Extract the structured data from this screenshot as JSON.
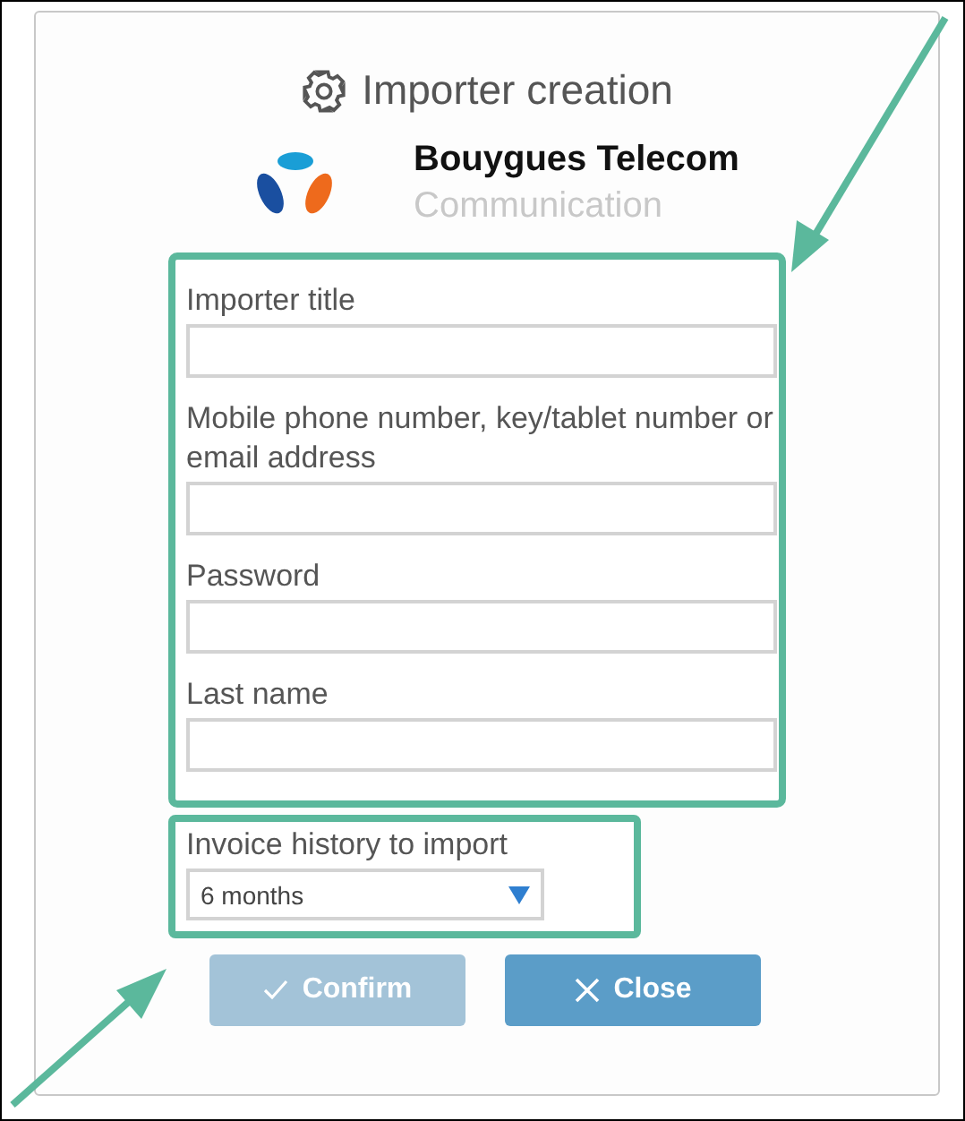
{
  "dialog": {
    "title": "Importer creation"
  },
  "provider": {
    "name": "Bouygues Telecom",
    "category": "Communication"
  },
  "fields": [
    {
      "label": "Importer title"
    },
    {
      "label": "Mobile phone number, key/tablet number or email address"
    },
    {
      "label": "Password"
    },
    {
      "label": "Last name"
    }
  ],
  "history": {
    "label": "Invoice history to import",
    "value": "6 months"
  },
  "buttons": [
    {
      "kind": "confirm",
      "label": "Confirm",
      "disabled": true
    },
    {
      "kind": "close",
      "label": "Close",
      "disabled": false
    }
  ]
}
